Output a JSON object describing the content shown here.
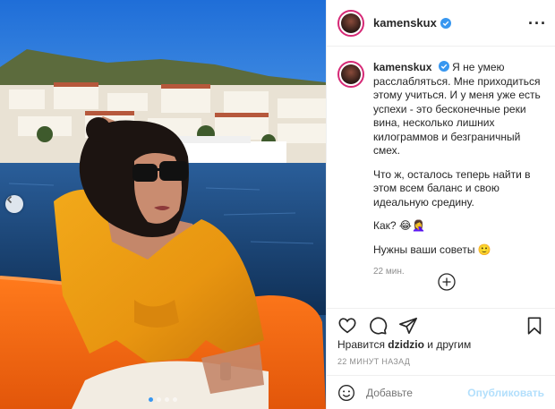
{
  "post": {
    "username": "kamenskux",
    "caption_paragraphs": [
      "Я не умею расслабляться. Мне приходиться этому учиться. И у меня уже есть успехи - это бесконечные реки вина, несколько лишних килограммов и безграничный смех.",
      "Что ж, осталось теперь найти в этом всем баланс и свою идеальную средину.",
      "Как? 😂🤦‍♀️",
      "Нужны ваши советы 🙂"
    ],
    "caption_time": "22 мин.",
    "likes_prefix": "Нравится ",
    "likes_user": "dzidzio",
    "likes_suffix": " и другим",
    "posted_time": "22 МИНУТ НАЗАД",
    "comment_placeholder": "Добавьте",
    "publish_label": "Опубликовать"
  },
  "carousel": {
    "dot_count": 4,
    "active_index": 0
  },
  "colors": {
    "verified": "#3897f0",
    "publish_disabled": "#b2dffc",
    "avatar_ring": "#d62976"
  },
  "icons": [
    "verified-icon",
    "more-options-icon",
    "carousel-prev-icon",
    "expand-comments-icon",
    "heart-icon",
    "comment-icon",
    "share-icon",
    "bookmark-icon",
    "emoji-icon"
  ]
}
